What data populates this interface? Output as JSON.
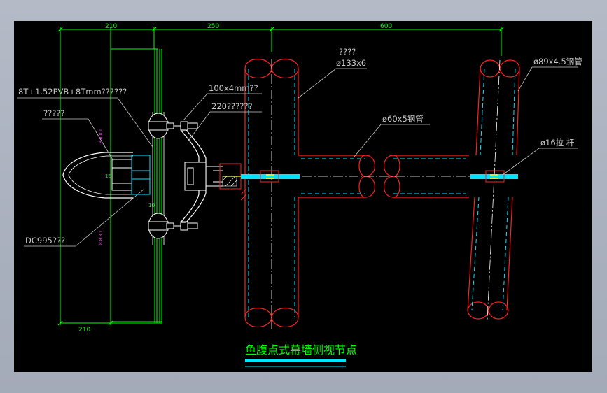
{
  "dims": {
    "d1": "210",
    "d2": "250",
    "d3": "600"
  },
  "labels": {
    "glass": "8T+1.52PVB+8Tmm??????",
    "cover": "?????",
    "plate": "100x4mm??",
    "spider": "220??????",
    "sealant": "DC995???",
    "pipe_main_name": "????",
    "pipe_main_size": "ø133x6",
    "pipe_mid": "ø60x5钢管",
    "pipe_right": "ø89x4.5钢管",
    "rod": "ø16拉 杆",
    "small_15": "15",
    "small_10": "10"
  },
  "title": "鱼腹点式幕墙侧视节点",
  "colors": {
    "background": "#000000",
    "dimension": "#00ff00",
    "leader": "#c8c8c8",
    "pipe": "#ff2020",
    "hidden": "#00e5ff",
    "rod": "#00e5ff",
    "title": "#00ff00",
    "magenta": "#ff40ff"
  }
}
